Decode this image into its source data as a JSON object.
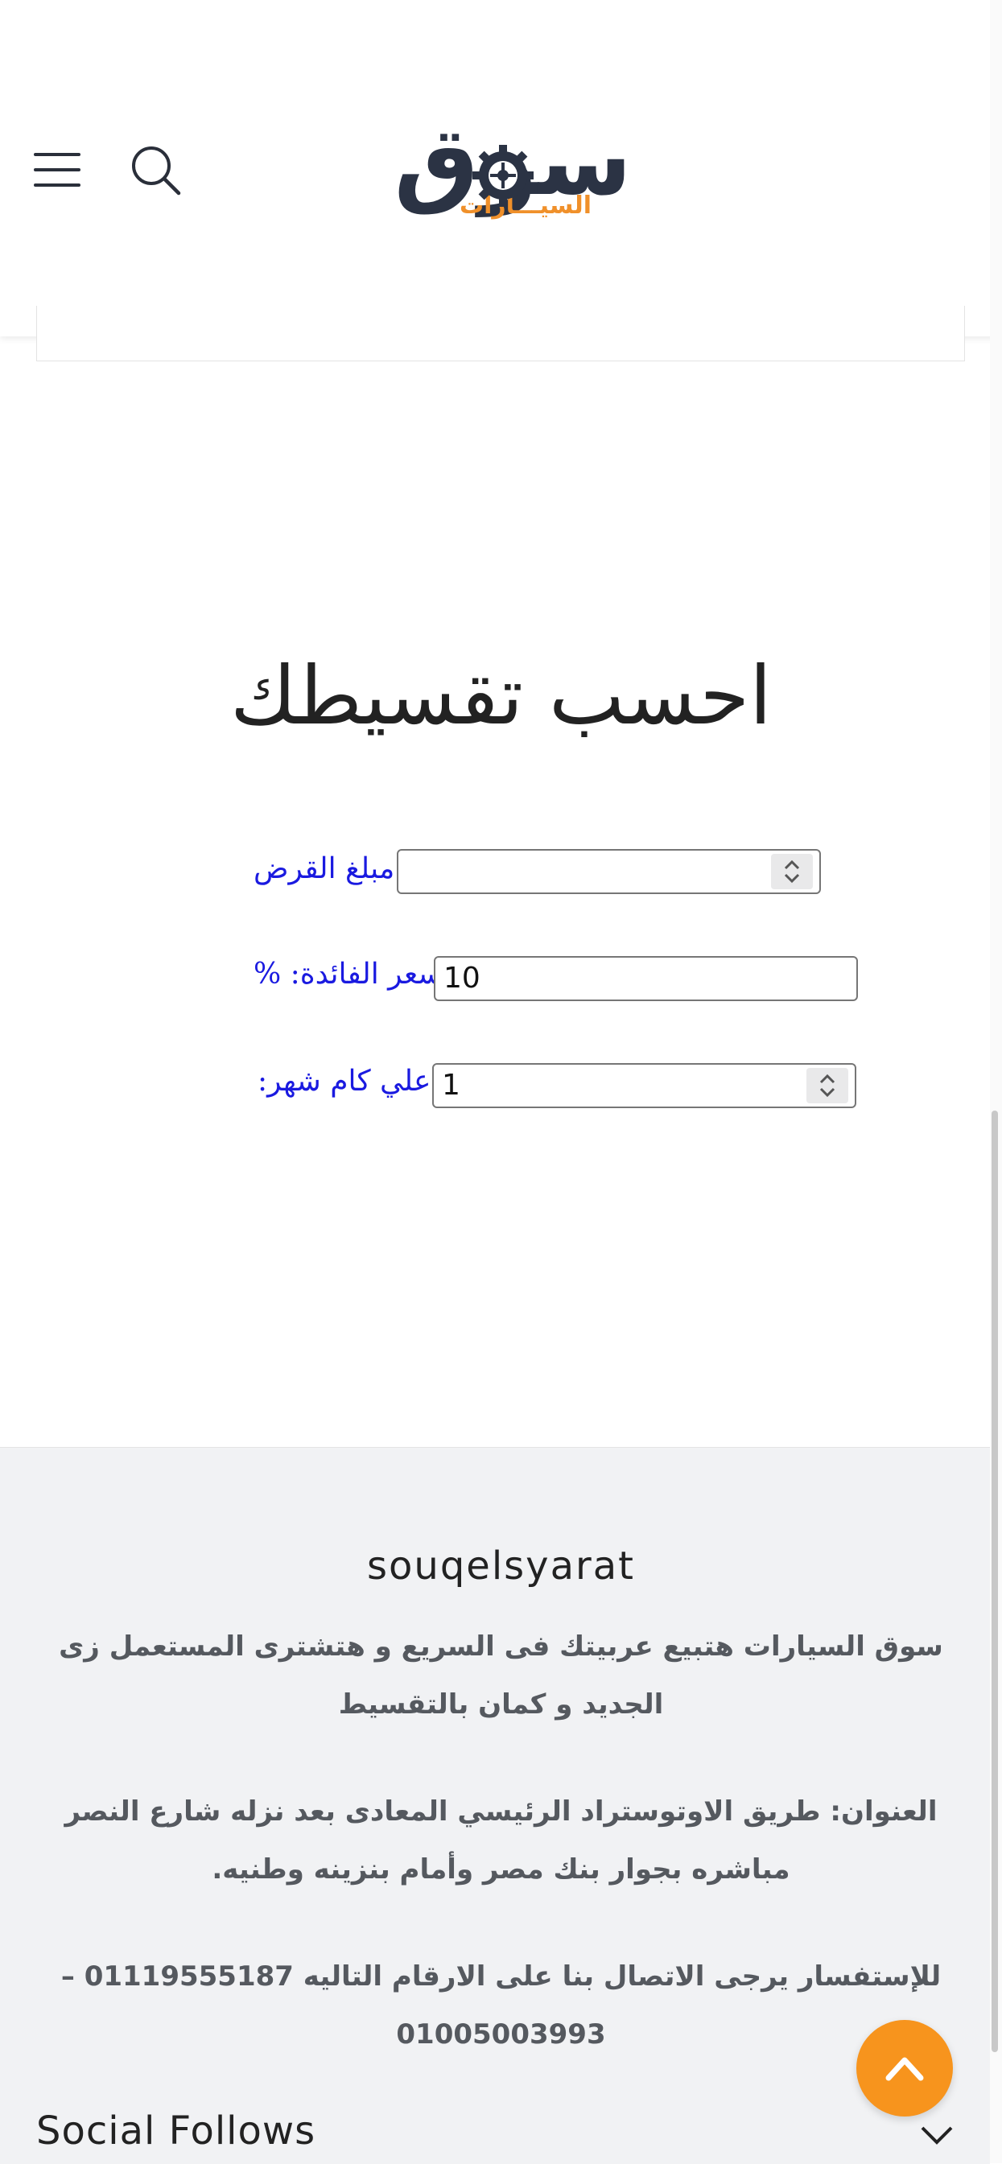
{
  "header": {
    "logo_main": "سوق",
    "logo_sub": "السيـــارات",
    "icons": [
      "menu-icon",
      "search-icon"
    ]
  },
  "calculator": {
    "title": "احسب تقسيطك",
    "loan_label": "مبلغ القرض",
    "loan_value": "",
    "rate_label": "سعر الفائدة: %",
    "rate_value": "10",
    "months_label": "علي كام شهر:",
    "months_value": "1"
  },
  "footer": {
    "site_name": "souqelsyarat",
    "about": "سوق السيارات هتبيع عربيتك فى السريع و هتشترى المستعمل زى الجديد و كمان بالتقسيط",
    "address": "العنوان: طريق الاوتوستراد الرئيسي المعادى بعد نزله شارع النصر مباشره بجوار بنك مصر وأمام بنزينه وطنيه.",
    "contact": "للإستفسار يرجى الاتصال بنا على الارقام التاليه 01119555187 – 01005003993",
    "social_title": "Social Follows"
  },
  "colors": {
    "accent": "#f7941d",
    "label_blue": "#1a1ae0",
    "logo_dark": "#2b3344",
    "logo_orange": "#f0902a"
  }
}
